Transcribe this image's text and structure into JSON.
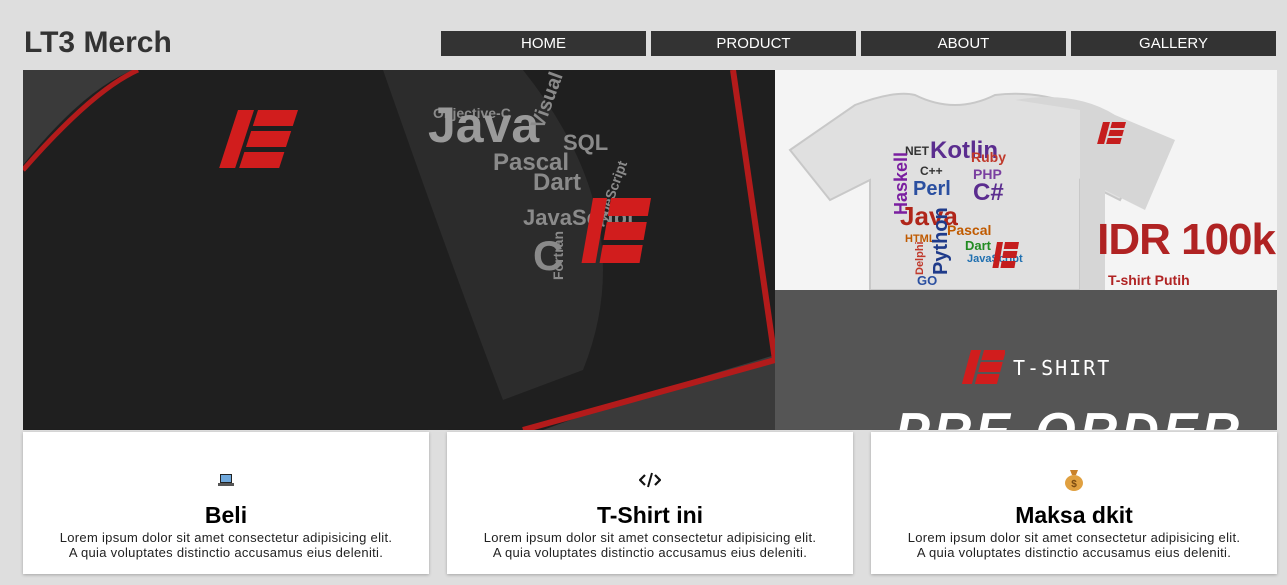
{
  "brand": {
    "title": "LT3 Merch"
  },
  "nav": {
    "items": [
      "HOME",
      "PRODUCT",
      "ABOUT",
      "GALLERY"
    ]
  },
  "hero": {
    "left_words": [
      "Objective-C",
      "Java",
      "Visual",
      "SQL",
      "Pascal",
      "TypeScript",
      "Dart",
      "JavaScript",
      "Fortran",
      "C"
    ],
    "right_top_words": [
      "NET",
      "Kotlin",
      "Ruby",
      "PHP",
      "Haskell",
      "C++",
      "Perl",
      "C#",
      "Java",
      "Pascal",
      "Dart",
      "HTML",
      "Delphi",
      "Python",
      "GO",
      "JavaScript"
    ],
    "price": "IDR 100k",
    "price_sub": "T-shirt Putih",
    "badge": "T-SHIRT",
    "banner": "PRE-ORDER"
  },
  "cards": [
    {
      "icon": "laptop-icon",
      "title": "Beli",
      "line1": "Lorem ipsum dolor sit amet consectetur adipisicing elit.",
      "line2": "A quia voluptates distinctio accusamus eius deleniti."
    },
    {
      "icon": "code-icon",
      "title": "T-Shirt ini",
      "line1": "Lorem ipsum dolor sit amet consectetur adipisicing elit.",
      "line2": "A quia voluptates distinctio accusamus eius deleniti."
    },
    {
      "icon": "money-bag-icon",
      "title": "Maksa dkit",
      "line1": "Lorem ipsum dolor sit amet consectetur adipisicing elit.",
      "line2": "A quia voluptates distinctio accusamus eius deleniti."
    }
  ],
  "colors": {
    "accent": "#b02323",
    "nav_bg": "#333333",
    "page_bg": "#dedede"
  }
}
